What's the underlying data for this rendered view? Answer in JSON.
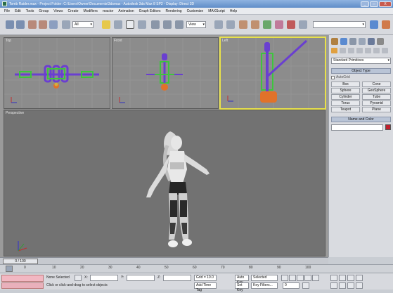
{
  "window": {
    "title": "Tomb Raider.max - Project Folder: C:\\Users\\Owner\\Documents\\3dsmax - Autodesk 3ds Max 8 SP2 - Display: Direct 3D",
    "buttons": [
      "_",
      "□",
      "X"
    ]
  },
  "menu": [
    "File",
    "Edit",
    "Tools",
    "Group",
    "Views",
    "Create",
    "Modifiers",
    "reactor",
    "Animation",
    "Graph Editors",
    "Rendering",
    "Customize",
    "MAXScript",
    "Help"
  ],
  "toolbar": {
    "selection_filter": "All",
    "reference_coord": "View",
    "named_selection": ""
  },
  "viewports": {
    "top_label": "Top",
    "front_label": "Front",
    "left_label": "Left",
    "perspective_label": "Perspective"
  },
  "command_panel": {
    "category": "Standard Primitives",
    "object_type_title": "Object Type",
    "autogrid_label": "AutoGrid",
    "buttons": [
      "Box",
      "Cone",
      "Sphere",
      "GeoSphere",
      "Cylinder",
      "Tube",
      "Torus",
      "Pyramid",
      "Teapot",
      "Plane"
    ],
    "name_color_title": "Name and Color",
    "name_value": ""
  },
  "timeline": {
    "slider_label": "0 / 100",
    "ticks": [
      "0",
      "10",
      "20",
      "30",
      "40",
      "50",
      "60",
      "70",
      "80",
      "90",
      "100"
    ]
  },
  "status": {
    "selection": "None Selected",
    "prompt": "Click or click-and-drag to select objects",
    "x_label": "X:",
    "y_label": "Y:",
    "z_label": "Z:",
    "grid": "Grid = 10.0",
    "add_time_tag": "Add Time Tag",
    "auto_key": "Auto Key",
    "selected": "Selected",
    "set_key": "Set Key",
    "key_filters": "Key Filters...",
    "frame": "0"
  },
  "colors": {
    "active_viewport_border": "#e8e14a",
    "skeleton_green": "#3ec43e",
    "skeleton_purple": "#6a3fd0",
    "skeleton_orange": "#e0722a",
    "object_color": "#c0202e"
  }
}
